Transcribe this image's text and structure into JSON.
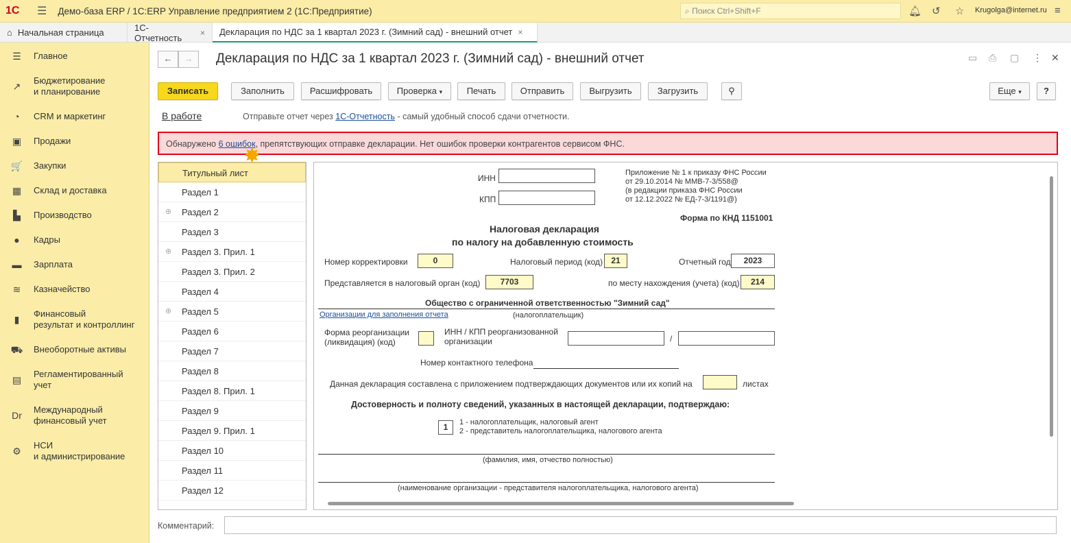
{
  "app": {
    "title": "Демо-база ERP / 1С:ERP Управление предприятием 2  (1С:Предприятие)",
    "search_placeholder": "Поиск Ctrl+Shift+F",
    "user": "Krugolga@internet.ru",
    "logo": "1С"
  },
  "tabs": [
    {
      "label": "Начальная страница"
    },
    {
      "label": "1С-Отчетность"
    },
    {
      "label": "Декларация по НДС за 1 квартал 2023 г. (Зимний сад) - внешний отчет"
    }
  ],
  "sidebar": [
    {
      "label": "Главное",
      "icon": "☰"
    },
    {
      "label": "Бюджетирование\nи планирование",
      "icon": "↗"
    },
    {
      "label": "CRM и маркетинг",
      "icon": "◔"
    },
    {
      "label": "Продажи",
      "icon": "▣"
    },
    {
      "label": "Закупки",
      "icon": "🛒"
    },
    {
      "label": "Склад и доставка",
      "icon": "▦"
    },
    {
      "label": "Производство",
      "icon": "▙"
    },
    {
      "label": "Кадры",
      "icon": "●"
    },
    {
      "label": "Зарплата",
      "icon": "▬"
    },
    {
      "label": "Казначейство",
      "icon": "≋"
    },
    {
      "label": "Финансовый\nрезультат и контроллинг",
      "icon": "▮"
    },
    {
      "label": "Внеоборотные активы",
      "icon": "⛟"
    },
    {
      "label": "Регламентированный\nучет",
      "icon": "▤"
    },
    {
      "label": "Международный\nфинансовый учет",
      "icon": "Dr"
    },
    {
      "label": "НСИ\nи администрирование",
      "icon": "⚙"
    }
  ],
  "doc": {
    "title": "Декларация по НДС за 1 квартал 2023 г. (Зимний сад) - внешний отчет"
  },
  "toolbar": {
    "save": "Записать",
    "fill": "Заполнить",
    "decode": "Расшифровать",
    "check": "Проверка",
    "print": "Печать",
    "send": "Отправить",
    "export": "Выгрузить",
    "import": "Загрузить",
    "more": "Еще",
    "help": "?"
  },
  "status": {
    "state": "В работе",
    "hint_pre": "Отправьте отчет через ",
    "hint_link": "1С-Отчетность",
    "hint_post": " - самый удобный способ сдачи отчетности."
  },
  "error": {
    "pre": "Обнаружено ",
    "link": "6 ошибок",
    "post": ", препятствующих отправке декларации. Нет ошибок проверки контрагентов сервисом ФНС."
  },
  "sections": [
    "Титульный лист",
    "Раздел 1",
    "Раздел 2",
    "Раздел 3",
    "Раздел 3. Прил. 1",
    "Раздел 3. Прил. 2",
    "Раздел 4",
    "Раздел 5",
    "Раздел 6",
    "Раздел 7",
    "Раздел 8",
    "Раздел 8. Прил. 1",
    "Раздел 9",
    "Раздел 9. Прил. 1",
    "Раздел 10",
    "Раздел 11",
    "Раздел 12"
  ],
  "form": {
    "inn": "ИНН",
    "kpp": "КПП",
    "app1": "Приложение № 1 к приказу ФНС России",
    "app2": "от 29.10.2014 № ММВ-7-3/558@",
    "app3": "(в редакции приказа ФНС России",
    "app4": "от 12.12.2022 № ЕД-7-3/1191@)",
    "knd": "Форма по КНД 1151001",
    "h1": "Налоговая декларация",
    "h2": "по налогу на добавленную стоимость",
    "corr_l": "Номер корректировки",
    "corr": "0",
    "period_l": "Налоговый период (код)",
    "period": "21",
    "year_l": "Отчетный год",
    "year": "2023",
    "organ_l": "Представляется в налоговый орган (код)",
    "organ": "7703",
    "place_l": "по месту нахождения (учета) (код)",
    "place": "214",
    "org": "Общество с ограниченной ответственностью \"Зимний сад\"",
    "org_link": "Организации для заполнения отчета",
    "payer": "(налогоплательщик)",
    "reorg_l1": "Форма реорганизации",
    "reorg_l2": "(ликвидация) (код)",
    "reorg_inn1": "ИНН / КПП реорганизованной",
    "reorg_inn2": "организации",
    "slash": "/",
    "phone": "Номер контактного телефона",
    "pages_l": "Данная декларация составлена с приложением подтверждающих документов или их копий на",
    "pages_r": "листах",
    "confirm": "Достоверность и полноту сведений, указанных в настоящей декларации, подтверждаю:",
    "signer": "1",
    "opt1": "1 - налогоплательщик, налоговый агент",
    "opt2": "2 - представитель налогоплательщика, налогового агента",
    "fio": "(фамилия, имя, отчество полностью)",
    "rep": "(наименование организации - представителя налогоплательщика, налогового агента)"
  },
  "comment_label": "Комментарий:"
}
